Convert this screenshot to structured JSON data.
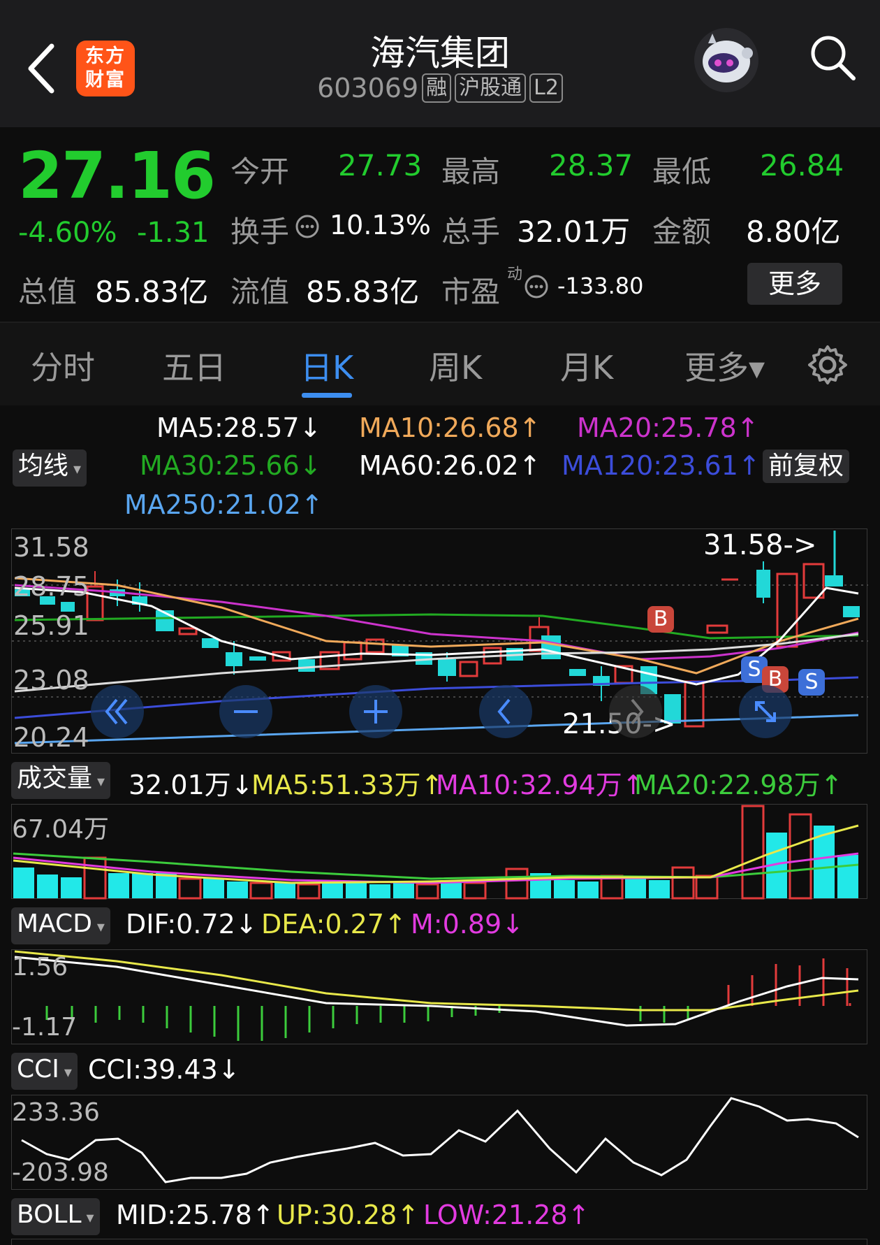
{
  "header": {
    "title": "海汽集团",
    "code": "603069",
    "tags": [
      "融",
      "沪股通",
      "L2"
    ],
    "logo_text_1": "东方",
    "logo_text_2": "财富"
  },
  "quote": {
    "price": "27.16",
    "change_pct": "-4.60%",
    "change_abs": "-1.31",
    "open_label": "今开",
    "open": "27.73",
    "high_label": "最高",
    "high": "28.37",
    "low_label": "最低",
    "low": "26.84",
    "turnover_label": "换手",
    "turnover": "10.13%",
    "volume_label": "总手",
    "volume": "32.01万",
    "amount_label": "金额",
    "amount": "8.80亿",
    "mktcap_label": "总值",
    "mktcap": "85.83亿",
    "float_label": "流值",
    "float_cap": "85.83亿",
    "pe_label": "市盈",
    "pe_sup": "动",
    "pe": "-133.80",
    "more_button": "更多"
  },
  "tabs": [
    {
      "label": "分时"
    },
    {
      "label": "五日"
    },
    {
      "label": "日K",
      "active": true
    },
    {
      "label": "周K"
    },
    {
      "label": "月K"
    },
    {
      "label": "更多▾"
    }
  ],
  "ma_legend": {
    "selector": "均线",
    "adjust": "前复权",
    "ma5": "MA5:28.57↓",
    "ma10": "MA10:26.68↑",
    "ma20": "MA20:25.78↑",
    "ma30": "MA30:25.66↓",
    "ma60": "MA60:26.02↑",
    "ma120": "MA120:23.61↑",
    "ma250": "MA250:21.02↑"
  },
  "kline": {
    "y_labels": [
      "31.58",
      "28.75",
      "25.91",
      "23.08",
      "20.24"
    ],
    "high_marker": "31.58->",
    "low_marker": "21.50->",
    "signals": [
      "B",
      "S",
      "B",
      "S"
    ]
  },
  "volume": {
    "selector": "成交量",
    "current": "32.01万↓",
    "ma5": "MA5:51.33万↑",
    "ma10": "MA10:32.94万↑",
    "ma20": "MA20:22.98万↑",
    "y_max": "67.04万"
  },
  "macd": {
    "selector": "MACD",
    "dif": "DIF:0.72↓",
    "dea": "DEA:0.27↑",
    "m": "M:0.89↓",
    "y_max": "1.56",
    "y_min": "-1.17"
  },
  "cci": {
    "selector": "CCI",
    "value": "CCI:39.43↓",
    "y_max": "233.36",
    "y_min": "-203.98"
  },
  "boll": {
    "selector": "BOLL",
    "mid": "MID:25.78↑",
    "up": "UP:30.28↑",
    "low": "LOW:21.28↑"
  },
  "colors": {
    "down": "#22cc2e",
    "up": "#e23b3b",
    "accent": "#3d8ef0",
    "ma10": "#f0a95a",
    "ma20": "#cc33cc",
    "ma30": "#22aa22",
    "ma120": "#3c4ddb",
    "ma250": "#5aa6f0"
  }
}
